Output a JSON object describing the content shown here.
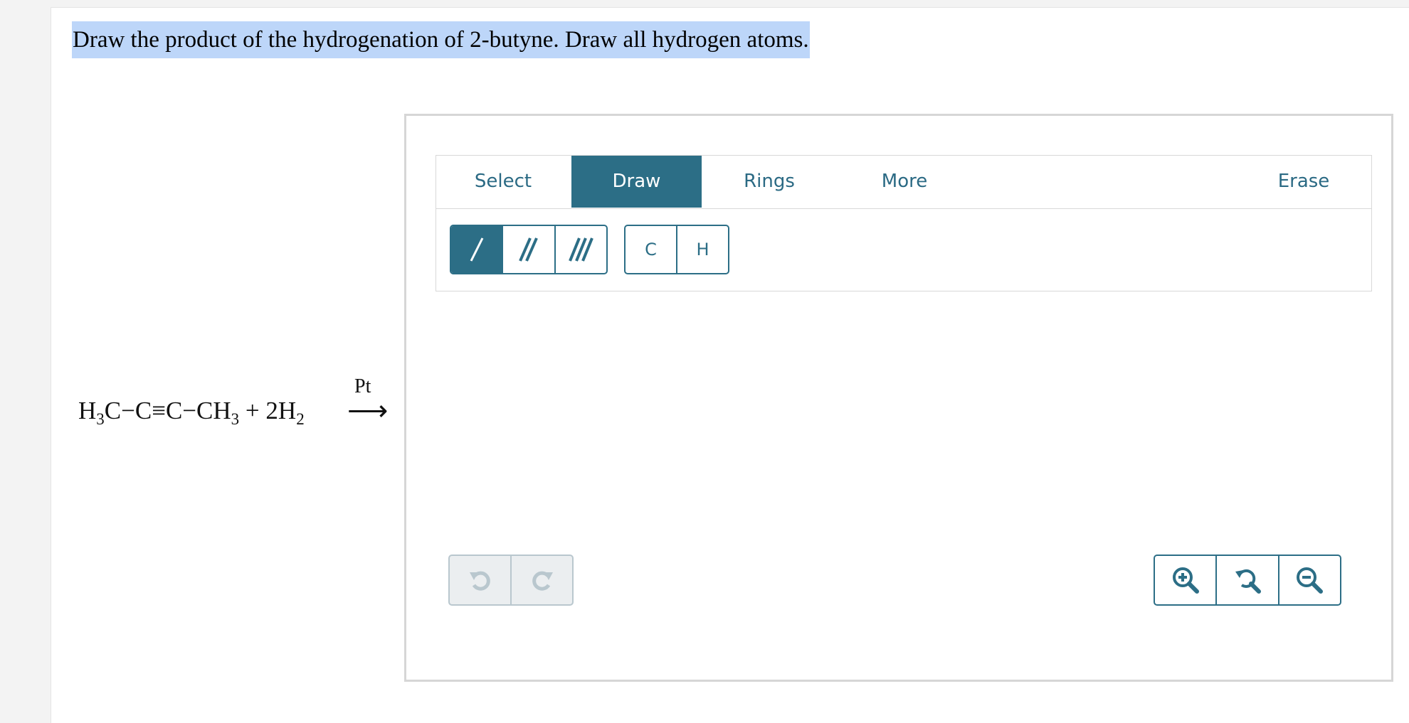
{
  "question": {
    "text": "Draw the product of the hydrogenation of 2-butyne. Draw all hydrogen atoms."
  },
  "reaction": {
    "reactant_1": {
      "h": "H",
      "h_sub": "3",
      "chain": "C−C≡C−CH",
      "ch3_sub": "3"
    },
    "plus": "+ 2",
    "reactant_2": {
      "h": "H",
      "h_sub": "2"
    },
    "catalyst": "Pt",
    "arrow": "⟶"
  },
  "editor": {
    "tabs": [
      {
        "label": "Select",
        "active": false
      },
      {
        "label": "Draw",
        "active": true
      },
      {
        "label": "Rings",
        "active": false
      },
      {
        "label": "More",
        "active": false
      },
      {
        "label": "Erase",
        "active": false
      }
    ],
    "bond_tools": [
      {
        "icon": "single-bond-icon",
        "active": true
      },
      {
        "icon": "double-bond-icon",
        "active": false
      },
      {
        "icon": "triple-bond-icon",
        "active": false
      }
    ],
    "atom_tools": [
      {
        "label": "C"
      },
      {
        "label": "H"
      }
    ],
    "history": [
      {
        "icon": "undo-icon",
        "enabled": false
      },
      {
        "icon": "redo-icon",
        "enabled": false
      }
    ],
    "zoom": [
      {
        "icon": "zoom-in-icon"
      },
      {
        "icon": "zoom-reset-icon"
      },
      {
        "icon": "zoom-out-icon"
      }
    ]
  },
  "colors": {
    "accent": "#2c6e86",
    "selection_highlight": "#bdd6f9",
    "disabled": "#b9c7ce"
  }
}
